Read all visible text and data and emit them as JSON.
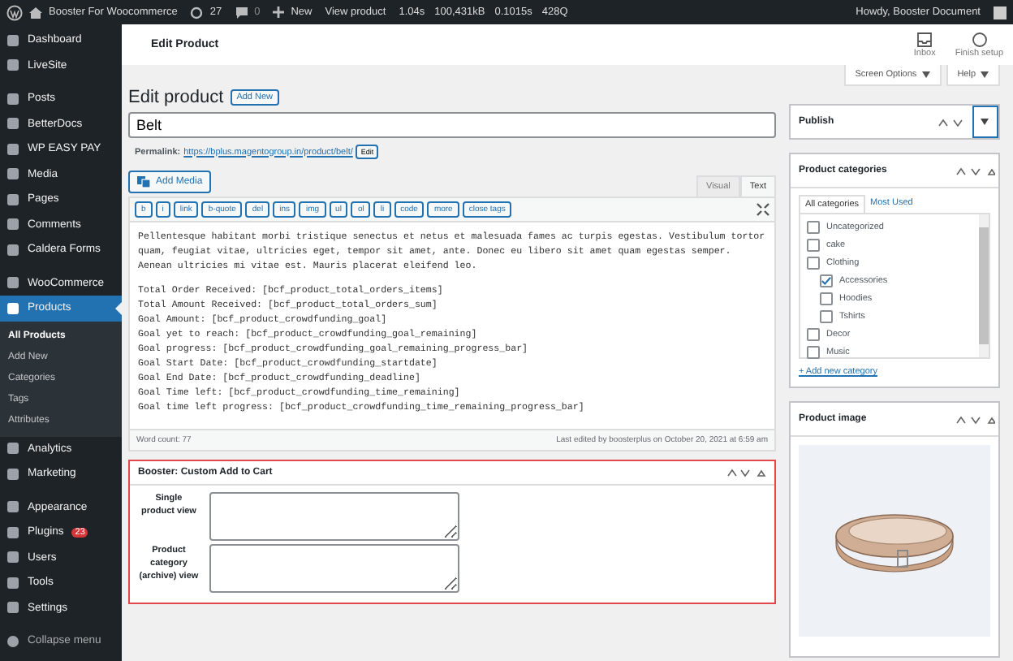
{
  "admin_bar": {
    "site_name": "Booster For Woocommerce",
    "updates": "27",
    "comments": "0",
    "new": "New",
    "view": "View product",
    "stats": [
      "1.04s",
      "100,431kB",
      "0.1015s",
      "428Q"
    ],
    "greeting": "Howdy, Booster Document"
  },
  "sidebar": {
    "groups": [
      [
        {
          "label": "Dashboard",
          "selected": false
        },
        {
          "label": "LiveSite",
          "selected": false
        }
      ],
      [
        {
          "label": "Posts",
          "selected": false
        },
        {
          "label": "BetterDocs",
          "selected": false
        },
        {
          "label": "WP EASY PAY",
          "selected": false
        },
        {
          "label": "Media",
          "selected": false
        },
        {
          "label": "Pages",
          "selected": false
        },
        {
          "label": "Comments",
          "selected": false
        },
        {
          "label": "Caldera Forms",
          "selected": false
        }
      ],
      [
        {
          "label": "WooCommerce",
          "selected": false
        },
        {
          "label": "Products",
          "selected": true,
          "submenu": [
            {
              "label": "All Products",
              "selected": true
            },
            {
              "label": "Add New",
              "selected": false
            },
            {
              "label": "Categories",
              "selected": false
            },
            {
              "label": "Tags",
              "selected": false
            },
            {
              "label": "Attributes",
              "selected": false
            }
          ]
        },
        {
          "label": "Analytics",
          "selected": false
        },
        {
          "label": "Marketing",
          "selected": false
        }
      ],
      [
        {
          "label": "Appearance",
          "selected": false
        },
        {
          "label": "Plugins",
          "selected": false,
          "badge": "23"
        },
        {
          "label": "Users",
          "selected": false
        },
        {
          "label": "Tools",
          "selected": false
        },
        {
          "label": "Settings",
          "selected": false
        }
      ]
    ],
    "collapse": "Collapse menu"
  },
  "header": {
    "title": "Edit Product",
    "actions": [
      {
        "label": "Inbox",
        "kind": "inbox"
      },
      {
        "label": "Finish setup",
        "kind": "circle"
      }
    ]
  },
  "screen_tabs": [
    "Screen Options",
    "Help"
  ],
  "page_title": "Edit product",
  "add_new": "Add New",
  "title_field": {
    "value": "Belt"
  },
  "permalink": {
    "label": "Permalink:",
    "url": "https://bplus.magentogroup.in/product/belt/",
    "edit": "Edit"
  },
  "editor": {
    "add_media": "Add Media",
    "tabs": [
      {
        "label": "Visual",
        "selected": false
      },
      {
        "label": "Text",
        "selected": true
      }
    ],
    "toolbar": [
      "b",
      "i",
      "link",
      "b-quote",
      "del",
      "ins",
      "img",
      "ul",
      "ol",
      "li",
      "code",
      "more",
      "close tags"
    ],
    "paragraph": "Pellentesque habitant morbi tristique senectus et netus et malesuada fames ac turpis egestas. Vestibulum tortor quam, feugiat vitae, ultricies eget, tempor sit amet, ante. Donec eu libero sit amet quam egestas semper. Aenean ultricies mi vitae est. Mauris placerat eleifend leo.",
    "lines": [
      "Total Order Received: [bcf_product_total_orders_items]",
      "Total Amount Received: [bcf_product_total_orders_sum]",
      "Goal Amount: [bcf_product_crowdfunding_goal]",
      "Goal yet to reach: [bcf_product_crowdfunding_goal_remaining]",
      "Goal progress: [bcf_product_crowdfunding_goal_remaining_progress_bar]",
      "Goal Start Date: [bcf_product_crowdfunding_startdate]",
      "Goal End Date: [bcf_product_crowdfunding_deadline]",
      "Goal Time left: [bcf_product_crowdfunding_time_remaining]",
      "Goal time left progress: [bcf_product_crowdfunding_time_remaining_progress_bar]"
    ],
    "word_count": "Word count: 77",
    "last_edited": "Last edited by boosterplus on October 20, 2021 at 6:59 am"
  },
  "booster_box": {
    "title": "Booster: Custom Add to Cart",
    "highlighted": true,
    "fields": [
      {
        "label": "Single product view"
      },
      {
        "label": "Product category (archive) view"
      }
    ]
  },
  "publish": {
    "title": "Publish"
  },
  "categories": {
    "title": "Product categories",
    "tabs": [
      {
        "label": "All categories",
        "selected": true
      },
      {
        "label": "Most Used",
        "selected": false
      }
    ],
    "items": [
      {
        "label": "Uncategorized",
        "checked": false
      },
      {
        "label": "cake",
        "checked": false
      },
      {
        "label": "Clothing",
        "checked": false,
        "children": [
          {
            "label": "Accessories",
            "checked": true
          },
          {
            "label": "Hoodies",
            "checked": false
          },
          {
            "label": "Tshirts",
            "checked": false
          }
        ]
      },
      {
        "label": "Decor",
        "checked": false
      },
      {
        "label": "Music",
        "checked": false
      }
    ],
    "add_link": "+ Add new category"
  },
  "product_image": {
    "title": "Product image"
  }
}
